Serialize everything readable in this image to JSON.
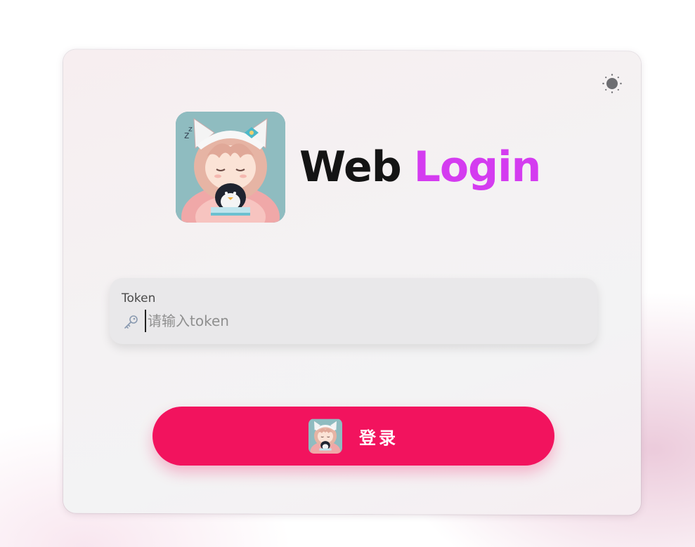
{
  "theme_toggle": {
    "icon": "sun-icon"
  },
  "logo": {
    "icon": "anime-girl-avatar-icon"
  },
  "title": {
    "word1": "Web",
    "word2": "Login"
  },
  "token_field": {
    "label": "Token",
    "icon": "key-icon",
    "value": "",
    "placeholder": "请输入token"
  },
  "login_button": {
    "label": "登录",
    "icon": "anime-girl-avatar-icon"
  },
  "colors": {
    "accent": "#f2135e",
    "title_accent": "#d43cf0",
    "title_text": "#141414"
  }
}
